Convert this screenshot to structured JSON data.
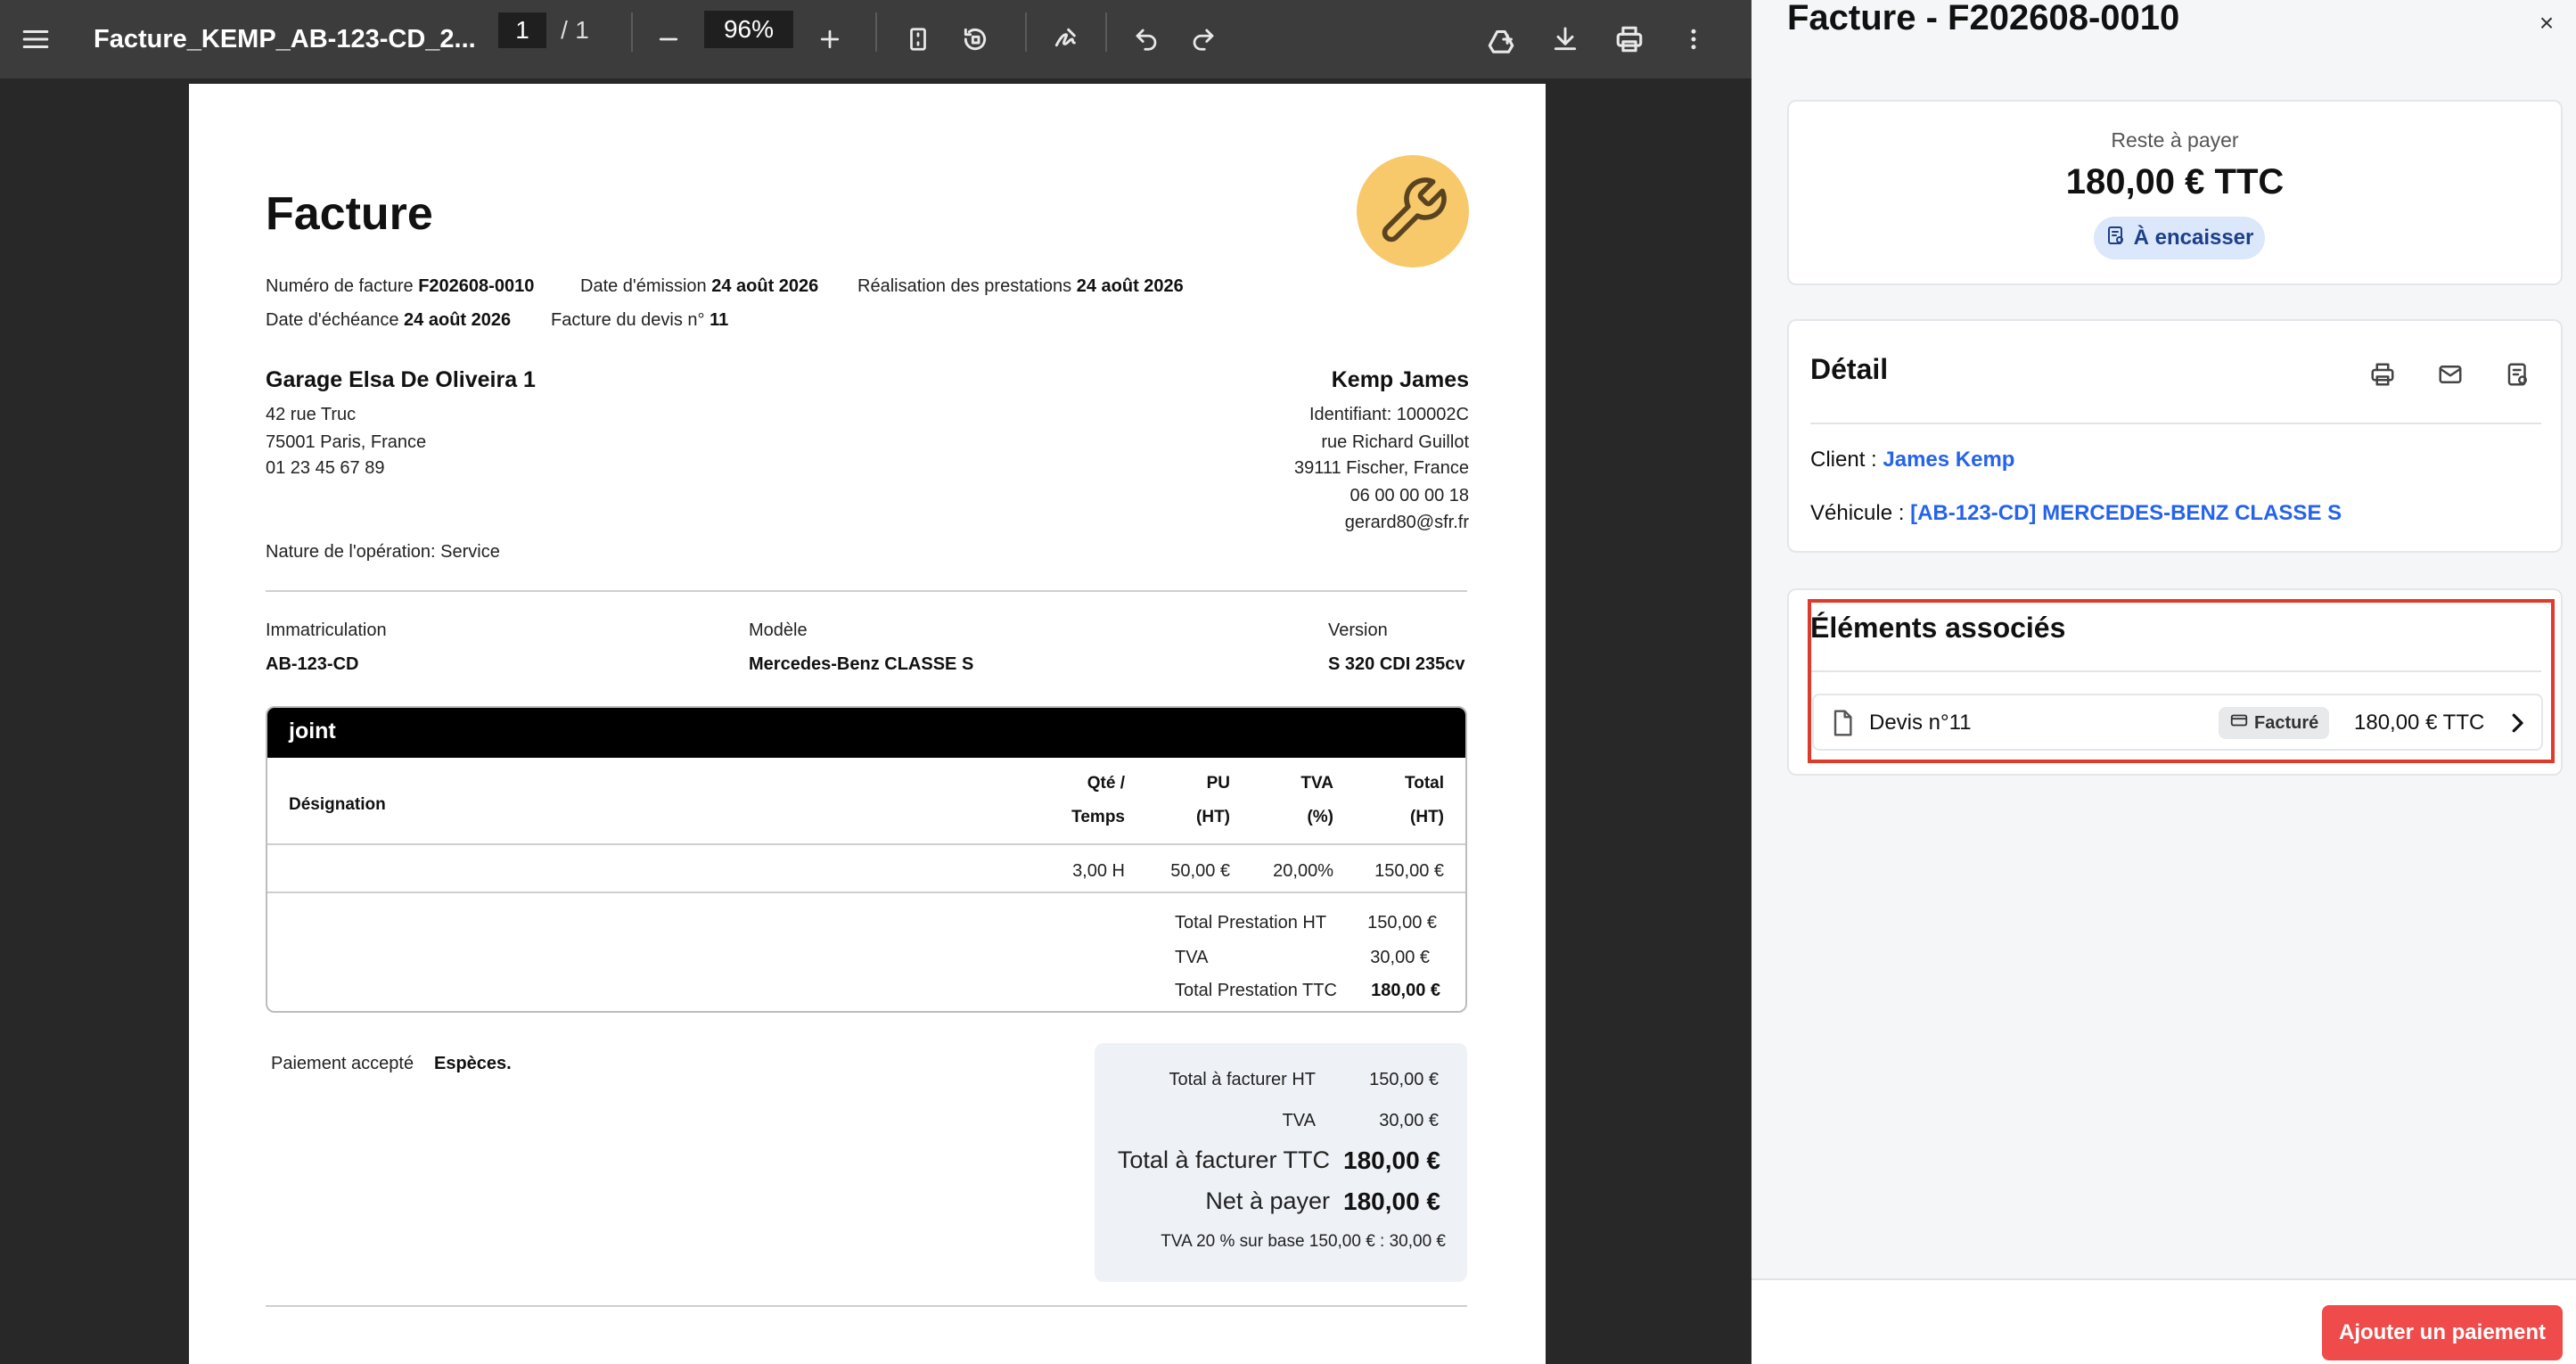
{
  "viewer": {
    "title": "Facture_KEMP_AB-123-CD_2...",
    "page_current": "1",
    "page_sep": "/",
    "page_total": "1",
    "zoom": "96%"
  },
  "invoice": {
    "heading": "Facture",
    "meta": {
      "number_label": "Numéro de facture",
      "number": "F202608-0010",
      "issue_label": "Date d'émission",
      "issue_date": "24 août 2026",
      "service_label": "Réalisation des prestations",
      "service_date": "24 août 2026",
      "due_label": "Date d'échéance",
      "due_date": "24 août 2026",
      "quote_label": "Facture du devis n°",
      "quote_no": "11"
    },
    "garage": {
      "name": "Garage Elsa De Oliveira 1",
      "line1": "42 rue Truc",
      "line2": "75001 Paris, France",
      "phone": "01 23 45 67 89"
    },
    "client": {
      "name": "Kemp James",
      "id": "Identifiant: 100002C",
      "street": "rue Richard Guillot",
      "city": "39111 Fischer, France",
      "phone": "06 00 00 00 18",
      "email": "gerard80@sfr.fr"
    },
    "nature": "Nature de l'opération: Service",
    "vehicle": {
      "plate_label": "Immatriculation",
      "plate": "AB-123-CD",
      "model_label": "Modèle",
      "model": "Mercedes-Benz CLASSE S",
      "version_label": "Version",
      "version": "S 320 CDI 235cv"
    },
    "service": {
      "name": "joint",
      "headers": {
        "designation": "Désignation",
        "qty1": "Qté /",
        "qty2": "Temps",
        "pu1": "PU",
        "pu2": "(HT)",
        "tva1": "TVA",
        "tva2": "(%)",
        "total1": "Total",
        "total2": "(HT)"
      },
      "row": {
        "qty": "3,00 H",
        "pu": "50,00 €",
        "tva": "20,00%",
        "total": "150,00 €"
      },
      "subtotals": {
        "ht_label": "Total Prestation HT",
        "ht": "150,00 €",
        "tva_label": "TVA",
        "tva": "30,00 €",
        "ttc_label": "Total Prestation TTC",
        "ttc": "180,00 €"
      }
    },
    "payment": {
      "label": "Paiement accepté",
      "value": "Espèces."
    },
    "totals": {
      "ht_label": "Total à facturer HT",
      "ht": "150,00 €",
      "tva_label": "TVA",
      "tva": "30,00 €",
      "ttc_label": "Total à facturer TTC",
      "ttc": "180,00 €",
      "net_label": "Net à payer",
      "net": "180,00 €",
      "tva_note": "TVA 20 % sur base 150,00 € : 30,00 €"
    },
    "logo_icon": "wrench-icon"
  },
  "panel": {
    "title": "Facture - F202608-0010",
    "close": "×",
    "due": {
      "label": "Reste à payer",
      "amount": "180,00 € TTC",
      "badge": "À encaisser"
    },
    "detail": {
      "title": "Détail",
      "client_label": "Client :",
      "client": "James Kemp",
      "vehicle_label": "Véhicule :",
      "vehicle": "[AB-123-CD] MERCEDES-BENZ CLASSE S"
    },
    "associated": {
      "title": "Éléments associés",
      "items": [
        {
          "label": "Devis n°11",
          "status": "Facturé",
          "amount": "180,00 € TTC"
        }
      ]
    },
    "add_payment": "Ajouter un paiement"
  },
  "colors": {
    "accent_red": "#ef4b4b",
    "link_blue": "#2563eb",
    "badge_blue": "#dbe7fb",
    "logo_yellow": "#f7c96b",
    "highlight": "#e03a2a"
  }
}
